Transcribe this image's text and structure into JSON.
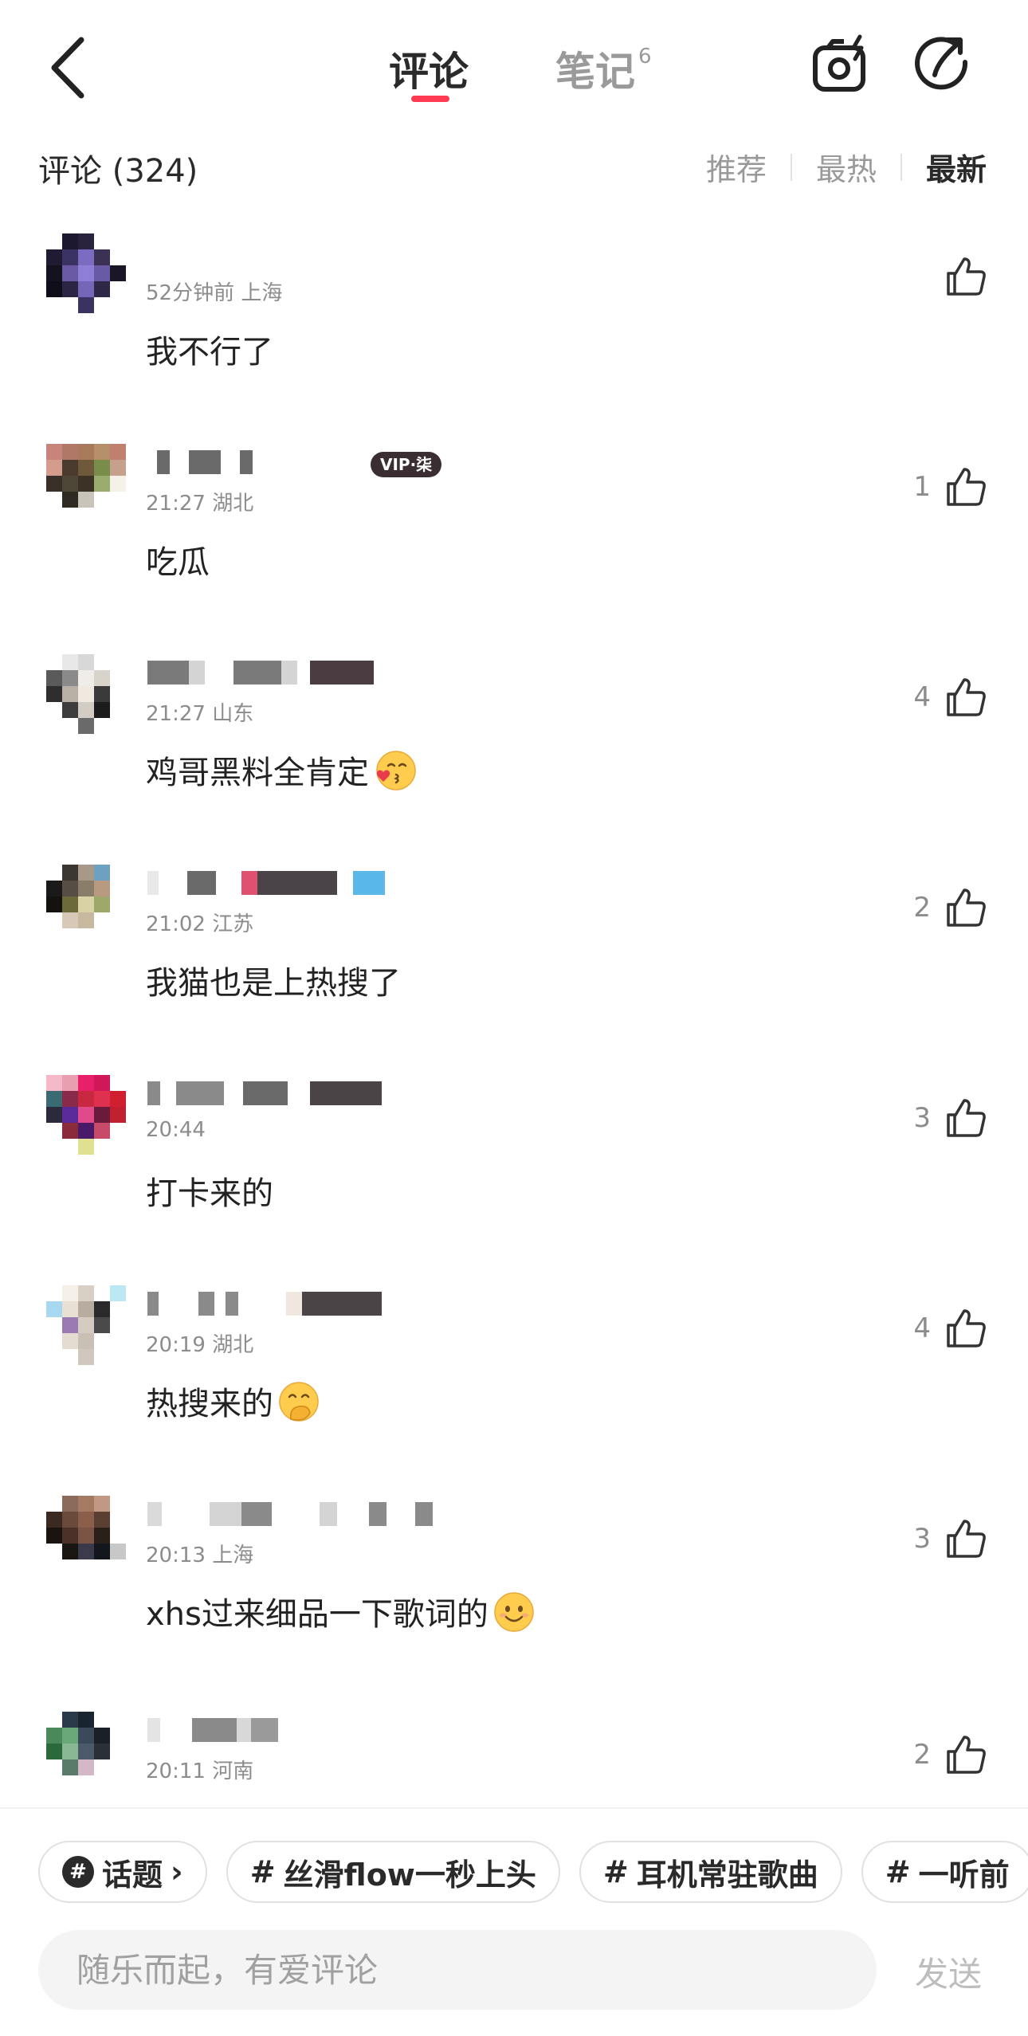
{
  "header": {
    "tabs": [
      {
        "label": "评论",
        "active": true
      },
      {
        "label": "笔记",
        "badge": "6",
        "active": false
      }
    ],
    "accent": "#ff3a52"
  },
  "sortbar": {
    "count_label": "评论 (324)",
    "options": [
      "推荐",
      "最热",
      "最新"
    ],
    "selected": "最新"
  },
  "comments": [
    {
      "time_location": "52分钟前 上海",
      "text": "我不行了",
      "likes": "",
      "vip": ""
    },
    {
      "time_location": "21:27 湖北",
      "text": "吃瓜",
      "likes": "1",
      "vip": "VIP·柒"
    },
    {
      "time_location": "21:27 山东",
      "text": "鸡哥黑料全肯定",
      "likes": "4",
      "vip": "",
      "emoji": "blowing-kiss-emoji"
    },
    {
      "time_location": "21:02 江苏",
      "text": "我猫也是上热搜了",
      "likes": "2",
      "vip": ""
    },
    {
      "time_location": "20:44",
      "text": "打卡来的",
      "likes": "3",
      "vip": ""
    },
    {
      "time_location": "20:19 湖北",
      "text": "热搜来的",
      "likes": "4",
      "vip": "",
      "emoji": "hand-over-mouth-emoji"
    },
    {
      "time_location": "20:13 上海",
      "text": "xhs过来细品一下歌词的",
      "likes": "3",
      "vip": "",
      "emoji": "smiling-emoji"
    },
    {
      "time_location": "20:11 河南",
      "text": "",
      "likes": "2",
      "vip": ""
    }
  ],
  "topics": {
    "main_label": "话题",
    "chips": [
      "丝滑flow一秒上头",
      "耳机常驻歌曲",
      "一听前"
    ]
  },
  "composer": {
    "placeholder": "随乐而起，有爱评论",
    "send_label": "发送"
  }
}
